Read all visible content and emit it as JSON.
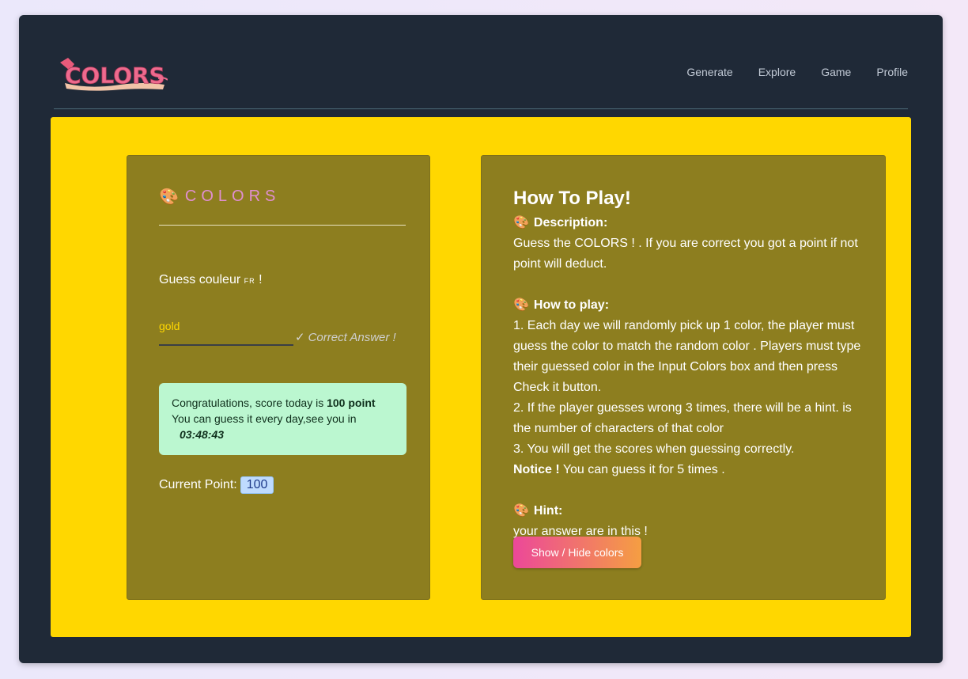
{
  "nav": {
    "logo_text": "COLORS",
    "links": [
      "Generate",
      "Explore",
      "Game",
      "Profile"
    ]
  },
  "game_card": {
    "brand_icon": "palette-icon",
    "brand_text": "COLORS",
    "prompt": "Guess couleur",
    "lang_tag": "FR",
    "prompt_suffix": "!",
    "input_value": "gold",
    "result_text": "Correct Answer !",
    "result_icon": "check-icon",
    "alert": {
      "line1_prefix": "Congratulations, score today is",
      "score": "100 point",
      "line2": "You can guess it every day,see you in",
      "countdown": "03:48:43"
    },
    "points_label": "Current Point:",
    "points_value": "100"
  },
  "how_to": {
    "title": "How To Play!",
    "description_head": "Description:",
    "description": "Guess the COLORS ! . If you are correct you got a point if not point will deduct.",
    "howto_head": "How to play:",
    "steps": [
      "1. Each day we will randomly pick up 1 color, the player must guess the color to match the random color . Players must type their guessed color in the Input Colors box and then press Check it button.",
      "2. If the player guesses wrong 3 times, there will be a hint. is the number of characters of that color",
      "3. You will get the scores when guessing correctly."
    ],
    "notice_label": "Notice !",
    "notice_text": "You can guess it for 5 times .",
    "hint_head": "Hint:",
    "hint_text": "your answer are in this !",
    "hint_button": "Show / Hide colors"
  },
  "colors": {
    "frame_bg": "#1f2937",
    "main_bg": "#ffd700",
    "card_bg": "#8d7e1f",
    "alert_bg": "#bbf7d0",
    "brand_accent": "#e08fd0"
  }
}
